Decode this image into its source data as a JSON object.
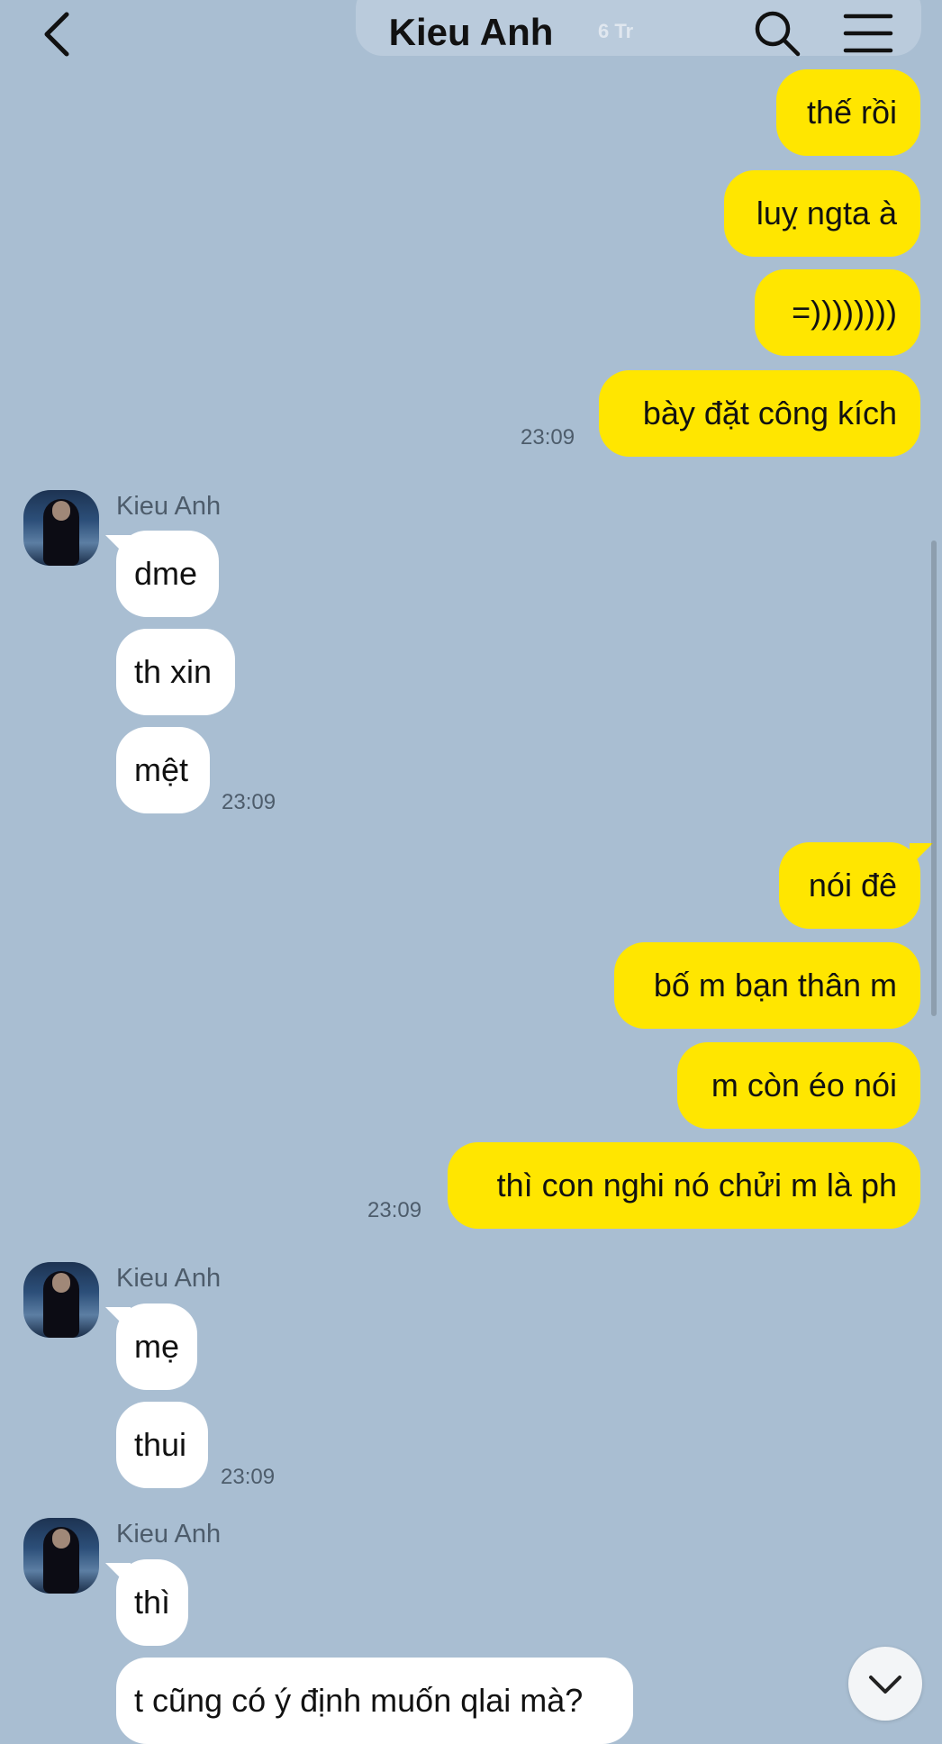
{
  "header": {
    "title": "Kieu Anh",
    "faint_text": "6 Tr",
    "icons": [
      "back-arrow-icon",
      "search-icon",
      "menu-icon"
    ]
  },
  "messages": [
    {
      "side": "out",
      "text": "thế rồi"
    },
    {
      "side": "out",
      "text": "luỵ ngta à"
    },
    {
      "side": "out",
      "text": "=))))))))"
    },
    {
      "side": "out",
      "text": "bày đặt công kích",
      "time": "23:09"
    },
    {
      "side": "in",
      "sender": "Kieu Anh",
      "text": "dme"
    },
    {
      "side": "in",
      "text": "th xin"
    },
    {
      "side": "in",
      "text": "mệt",
      "time": "23:09"
    },
    {
      "side": "out",
      "text": "nói đê"
    },
    {
      "side": "out",
      "text": "bố m bạn thân m"
    },
    {
      "side": "out",
      "text": "m còn éo nói"
    },
    {
      "side": "out",
      "text": "thì con nghi nó chửi m là ph",
      "time": "23:09"
    },
    {
      "side": "in",
      "sender": "Kieu Anh",
      "text": "mẹ"
    },
    {
      "side": "in",
      "text": "thui",
      "time": "23:09"
    },
    {
      "side": "in",
      "sender": "Kieu Anh",
      "text": "thì"
    },
    {
      "side": "in",
      "text": "t cũng có ý định muốn qlai mà?"
    }
  ],
  "colors": {
    "background": "#a9bed2",
    "outgoing_bubble": "#ffe600",
    "incoming_bubble": "#ffffff"
  },
  "scroll_down_icon": "chevron-down-icon"
}
